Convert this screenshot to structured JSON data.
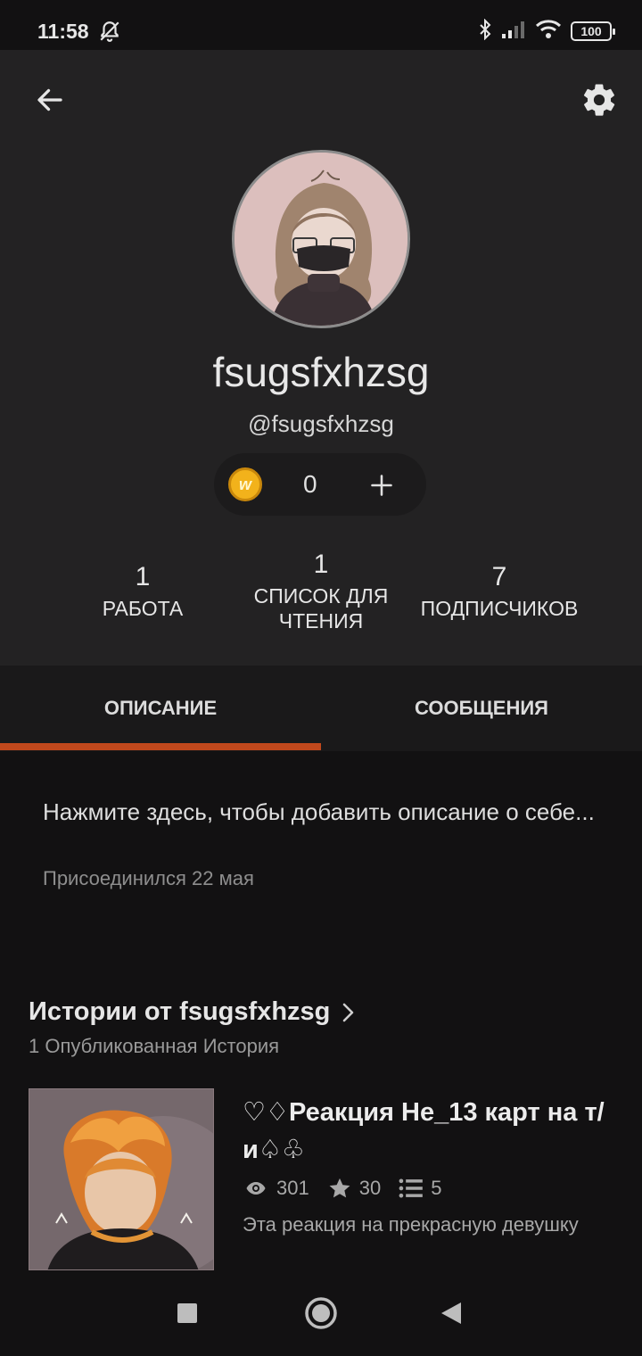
{
  "status_bar": {
    "time": "11:58",
    "battery": "100",
    "icons": [
      "bell-off-icon",
      "bluetooth-icon",
      "signal-icon",
      "wifi-icon",
      "battery-icon"
    ]
  },
  "header": {
    "back_icon": "arrow-left-icon",
    "settings_icon": "gear-icon"
  },
  "profile": {
    "display_name": "fsugsfxhzsg",
    "username": "@fsugsfxhzsg",
    "coins": "0",
    "coin_icon_letter": "w"
  },
  "stats": [
    {
      "value": "1",
      "label": "РАБОТА"
    },
    {
      "value": "1",
      "label_line1": "СПИСОК ДЛЯ",
      "label_line2": "ЧТЕНИЯ"
    },
    {
      "value": "7",
      "label": "ПОДПИСЧИКОВ"
    }
  ],
  "tabs": [
    {
      "label": "ОПИСАНИЕ",
      "active": true
    },
    {
      "label": "СООБЩЕНИЯ",
      "active": false
    }
  ],
  "about": {
    "description": "Нажмите здесь, чтобы добавить описание о себе...",
    "joined": "Присоединился 22 мая"
  },
  "stories": {
    "title": "Истории от fsugsfxhzsg",
    "count": "1 Опубликованная История",
    "items": [
      {
        "title": "♡♢Реакция Не_13 карт на т/и♤♧",
        "reads": "301",
        "votes": "30",
        "parts": "5",
        "description": "Эта реакция на прекрасную девушку"
      }
    ]
  },
  "colors": {
    "accent": "#c1481c",
    "header_bg": "#232223",
    "page_bg": "#121112",
    "coin": "#f2b21b"
  }
}
